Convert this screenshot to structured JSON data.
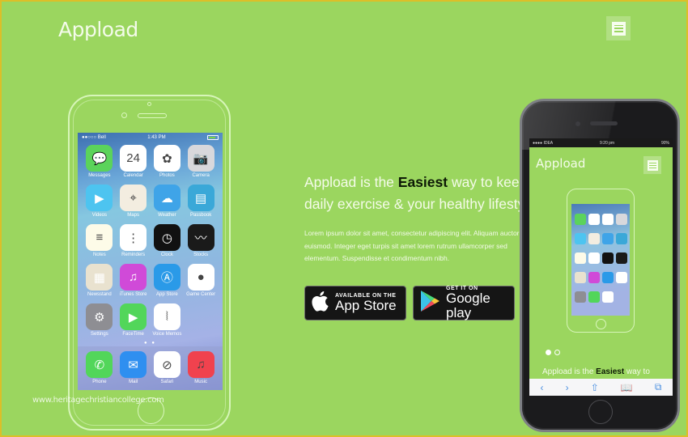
{
  "header": {
    "logo": "Appload",
    "menu_icon": "hamburger-menu-icon"
  },
  "hero": {
    "title_before": "Appload is the ",
    "title_emphasis": "Easiest",
    "title_after": " way to keep",
    "title_line2": "daily exercise & your healthy lifestyle",
    "body_lines": [
      "Lorem ipsum dolor sit amet, consectetur adipiscing elit. Aliquam auctor",
      "euismod. Integer eget turpis sit amet lorem rutrum ullamcorper sed",
      "elementum. Suspendisse et condimentum nibh."
    ]
  },
  "store_buttons": {
    "apple": {
      "small": "AVAILABLE ON THE",
      "large": "App Store"
    },
    "google": {
      "small": "GET IT ON",
      "large": "Google play"
    }
  },
  "left_phone": {
    "status": {
      "carrier": "●●○○○ Bell",
      "time": "1:43 PM"
    },
    "apps": [
      {
        "label": "Messages",
        "color": "#5bd35b",
        "glyph": "💬"
      },
      {
        "label": "Calendar",
        "color": "#ffffff",
        "glyph": "24"
      },
      {
        "label": "Photos",
        "color": "#ffffff",
        "glyph": "✿"
      },
      {
        "label": "Camera",
        "color": "#d8d8dc",
        "glyph": "📷"
      },
      {
        "label": "Videos",
        "color": "#4dc4f0",
        "glyph": "▶"
      },
      {
        "label": "Maps",
        "color": "#f3ede0",
        "glyph": "⌖"
      },
      {
        "label": "Weather",
        "color": "#3fa4e8",
        "glyph": "☁"
      },
      {
        "label": "Passbook",
        "color": "#3aa8d8",
        "glyph": "▤"
      },
      {
        "label": "Notes",
        "color": "#fdfbe8",
        "glyph": "≡"
      },
      {
        "label": "Reminders",
        "color": "#ffffff",
        "glyph": "⋮"
      },
      {
        "label": "Clock",
        "color": "#111111",
        "glyph": "◷"
      },
      {
        "label": "Stocks",
        "color": "#1a1a1a",
        "glyph": "〰"
      },
      {
        "label": "Newsstand",
        "color": "#e9e2cf",
        "glyph": "▦"
      },
      {
        "label": "iTunes Store",
        "color": "#d04ad8",
        "glyph": "♫"
      },
      {
        "label": "App Store",
        "color": "#2a9ae8",
        "glyph": "Ⓐ"
      },
      {
        "label": "Game Center",
        "color": "#ffffff",
        "glyph": "●"
      },
      {
        "label": "Settings",
        "color": "#8e8e93",
        "glyph": "⚙"
      },
      {
        "label": "FaceTime",
        "color": "#52d65a",
        "glyph": "▶"
      },
      {
        "label": "Voice Memos",
        "color": "#ffffff",
        "glyph": "⦚"
      }
    ],
    "page_dots": "● ●",
    "dock": [
      {
        "label": "Phone",
        "color": "#52d65a",
        "glyph": "✆"
      },
      {
        "label": "Mail",
        "color": "#2f8ff0",
        "glyph": "✉"
      },
      {
        "label": "Safari",
        "color": "#ffffff",
        "glyph": "⊘"
      },
      {
        "label": "Music",
        "color": "#f0424e",
        "glyph": "♫"
      }
    ]
  },
  "right_phone": {
    "status": {
      "carrier": "●●●● IDEA",
      "time": "9:20 pm",
      "battery": "90%"
    },
    "logo": "Appload",
    "text_before": "Appload is the ",
    "text_emphasis": "Easiest",
    "text_after": " way to",
    "toolbar": [
      "‹",
      "›",
      "⇧",
      "📖",
      "⧉"
    ]
  },
  "watermark": "www.heritagechristiancollege.com"
}
